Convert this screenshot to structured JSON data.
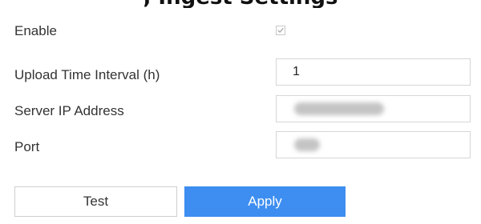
{
  "top_caption": ",  Ingest   Settings",
  "form": {
    "enable": {
      "label": "Enable",
      "checked": true
    },
    "upload_interval": {
      "label": "Upload Time Interval (h)",
      "value": "1"
    },
    "server_ip": {
      "label": "Server IP Address",
      "value_obscured": true
    },
    "port": {
      "label": "Port",
      "value_obscured": true
    }
  },
  "buttons": {
    "test": "Test",
    "apply": "Apply"
  },
  "colors": {
    "primary": "#3d8ef0",
    "border": "#d6d6d6",
    "text": "#333333"
  },
  "icons": {
    "enable_checkbox": "checkmark-icon"
  }
}
